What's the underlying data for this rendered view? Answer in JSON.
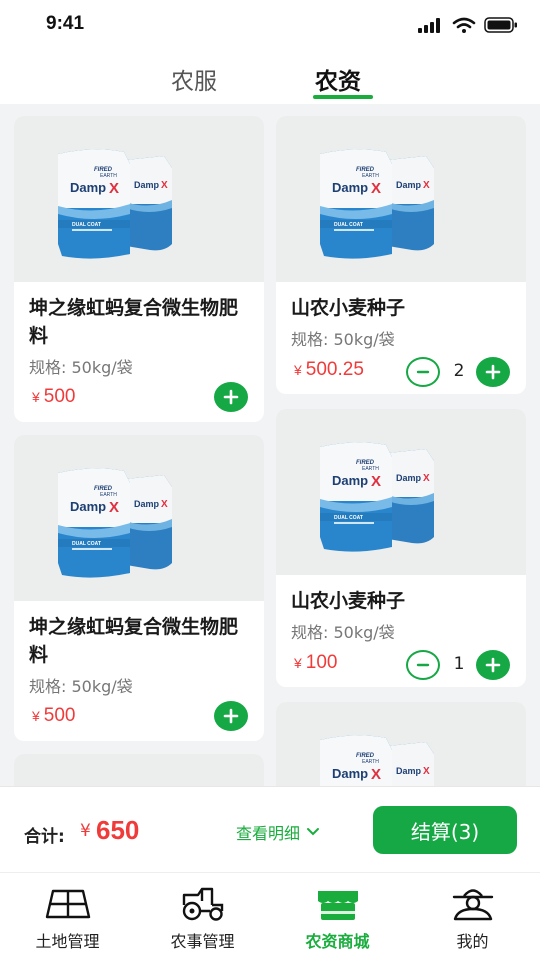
{
  "status": {
    "time": "9:41"
  },
  "top_tabs": [
    {
      "label": "农服",
      "active": false
    },
    {
      "label": "农资",
      "active": true
    }
  ],
  "product_image": {
    "brand_top": "FIRED EARTH",
    "brand": "DampX",
    "sub": "DUAL COAT"
  },
  "products": [
    {
      "name": "坤之缘虹蚂复合微生物肥料",
      "spec": "规格: 50kg/袋",
      "currency": "¥",
      "price": "500",
      "quantity": null
    },
    {
      "name": "山农小麦种子",
      "spec": "规格: 50kg/袋",
      "currency": "¥",
      "price": "500.25",
      "quantity": "2"
    },
    {
      "name": "坤之缘虹蚂复合微生物肥料",
      "spec": "规格: 50kg/袋",
      "currency": "¥",
      "price": "500",
      "quantity": null
    },
    {
      "name": "山农小麦种子",
      "spec": "规格: 50kg/袋",
      "currency": "¥",
      "price": "100",
      "quantity": "1"
    }
  ],
  "cart": {
    "total_label": "合计:",
    "currency": "¥",
    "total": "650",
    "detail_label": "查看明细",
    "checkout_label": "结算(3)"
  },
  "bottom_tabs": [
    {
      "label": "土地管理",
      "icon": "land-map-icon",
      "active": false
    },
    {
      "label": "农事管理",
      "icon": "tractor-icon",
      "active": false
    },
    {
      "label": "农资商城",
      "icon": "store-icon",
      "active": true
    },
    {
      "label": "我的",
      "icon": "farmer-profile-icon",
      "active": false
    }
  ],
  "colors": {
    "accent": "#1aad3e",
    "button_green": "#16a845",
    "price_red": "#f03b3b",
    "background": "#f2f3f5"
  }
}
